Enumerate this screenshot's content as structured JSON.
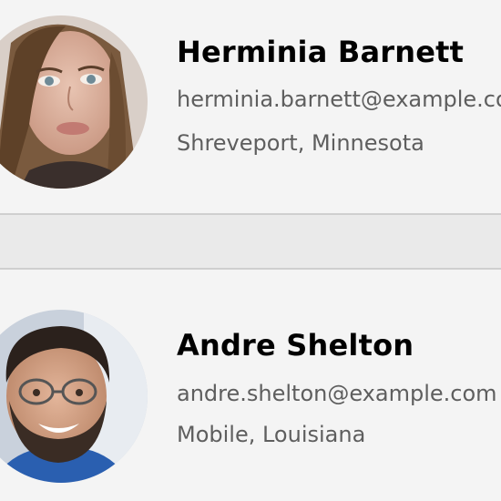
{
  "contacts": [
    {
      "name": "Herminia Barnett",
      "email": "herminia.barnett@example.com",
      "location": "Shreveport, Minnesota"
    },
    {
      "name": "Andre Shelton",
      "email": "andre.shelton@example.com",
      "location": "Mobile, Louisiana"
    }
  ]
}
